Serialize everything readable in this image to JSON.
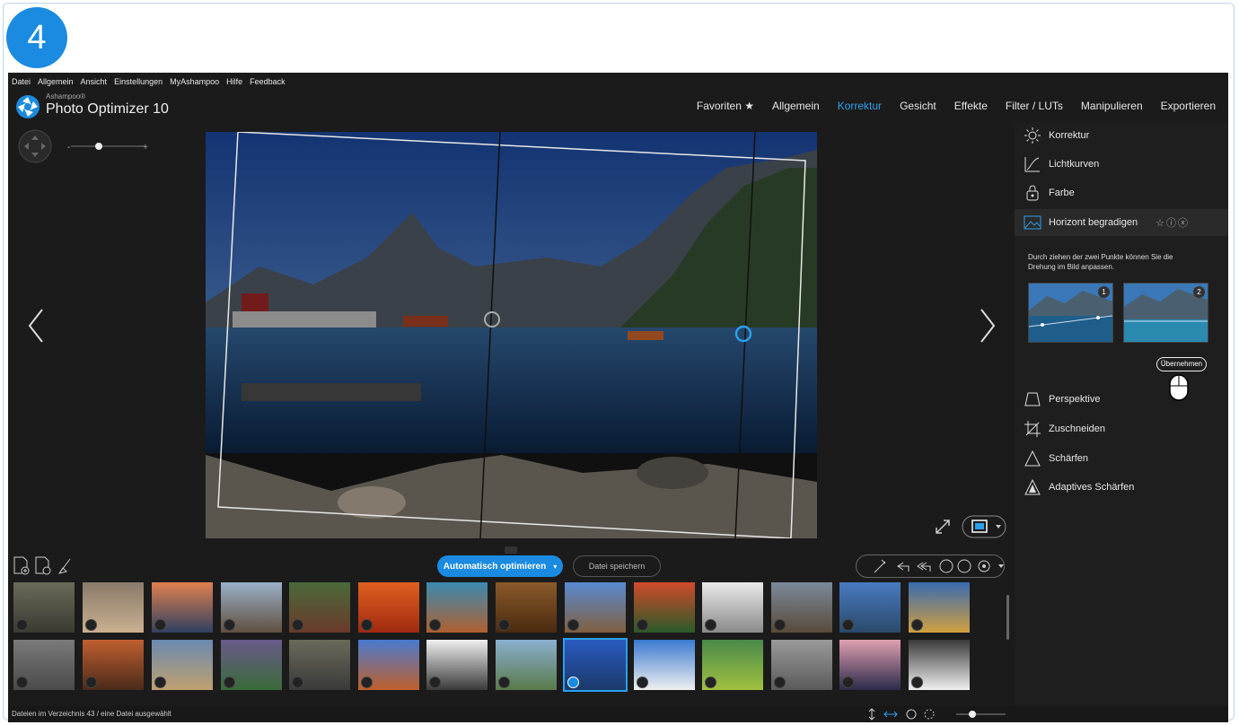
{
  "step_number": "4",
  "menu": [
    "Datei",
    "Allgemein",
    "Ansicht",
    "Einstellungen",
    "MyAshampoo",
    "Hilfe",
    "Feedback"
  ],
  "brand": {
    "company": "Ashampoo®",
    "product": "Photo Optimizer 10"
  },
  "topnav": [
    {
      "label": "Favoriten ★",
      "active": false
    },
    {
      "label": "Allgemein",
      "active": false
    },
    {
      "label": "Korrektur",
      "active": true
    },
    {
      "label": "Gesicht",
      "active": false
    },
    {
      "label": "Effekte",
      "active": false
    },
    {
      "label": "Filter / LUTs",
      "active": false
    },
    {
      "label": "Manipulieren",
      "active": false
    },
    {
      "label": "Exportieren",
      "active": false
    }
  ],
  "panel": {
    "items_top": [
      {
        "label": "Korrektur",
        "icon": "sun-icon"
      },
      {
        "label": "Lichtkurven",
        "icon": "curve-icon"
      },
      {
        "label": "Farbe",
        "icon": "color-icon"
      }
    ],
    "open_item": {
      "label": "Horizont begradigen",
      "icon": "landscape-icon"
    },
    "description": "Durch ziehen der zwei Punkte können Sie die Drehung im Bild anpassen.",
    "example_badges": [
      "1",
      "2"
    ],
    "apply_label": "Übernehmen",
    "items_bottom": [
      {
        "label": "Perspektive",
        "icon": "perspective-icon"
      },
      {
        "label": "Zuschneiden",
        "icon": "crop-icon"
      },
      {
        "label": "Schärfen",
        "icon": "sharpen-icon"
      },
      {
        "label": "Adaptives Schärfen",
        "icon": "adaptive-sharpen-icon"
      }
    ]
  },
  "toolbar": {
    "auto_optimize": "Automatisch optimieren",
    "save_file": "Datei speichern"
  },
  "status": "Dateien im Verzeichnis 43 / eine Datei ausgewählt",
  "colors": {
    "accent": "#1a8be0",
    "background": "#1b1b1b"
  }
}
